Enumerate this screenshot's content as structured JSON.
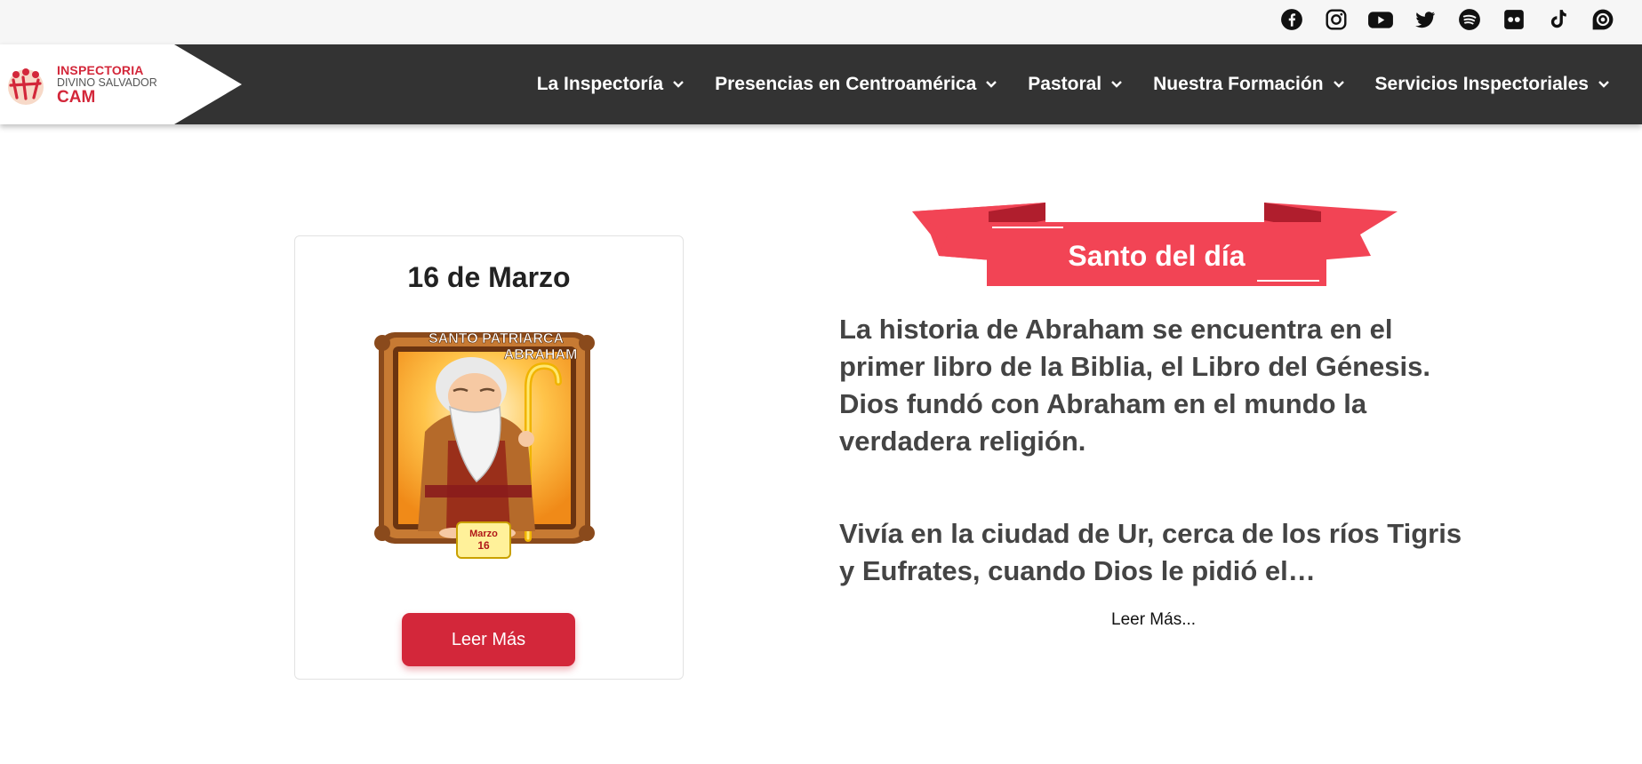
{
  "social": {
    "icons": [
      "facebook-icon",
      "instagram-icon",
      "youtube-icon",
      "twitter-icon",
      "spotify-icon",
      "flickr-icon",
      "tiktok-icon",
      "issuu-icon"
    ]
  },
  "logo": {
    "line1": "INSPECTORIA",
    "line2": "DIVINO SALVADOR",
    "line3": "CAM"
  },
  "nav": {
    "items": [
      {
        "label": "La Inspectoría"
      },
      {
        "label": "Presencias en Centroamérica"
      },
      {
        "label": "Pastoral"
      },
      {
        "label": "Nuestra Formación"
      },
      {
        "label": "Servicios Inspectoriales"
      }
    ]
  },
  "card": {
    "date": "16 de Marzo",
    "image_title_line1": "SANTO PATRIARCA",
    "image_title_line2": "ABRAHAM",
    "image_month": "Marzo",
    "image_day": "16",
    "button_label": "Leer Más"
  },
  "saint": {
    "banner": "Santo del día",
    "paragraph1": "La historia de Abraham se encuentra en el primer libro de la Biblia, el Libro del Génesis. Dios fundó con Abraham en el mundo la verdadera religión.",
    "paragraph2": "Vivía en la ciudad de Ur, cerca de los ríos Tigris y Eufrates, cuando Dios le pidió el…",
    "more_link": "Leer Más..."
  },
  "colors": {
    "brand_red": "#d3273a",
    "ribbon_red": "#f24455",
    "nav_bg": "#333333"
  }
}
